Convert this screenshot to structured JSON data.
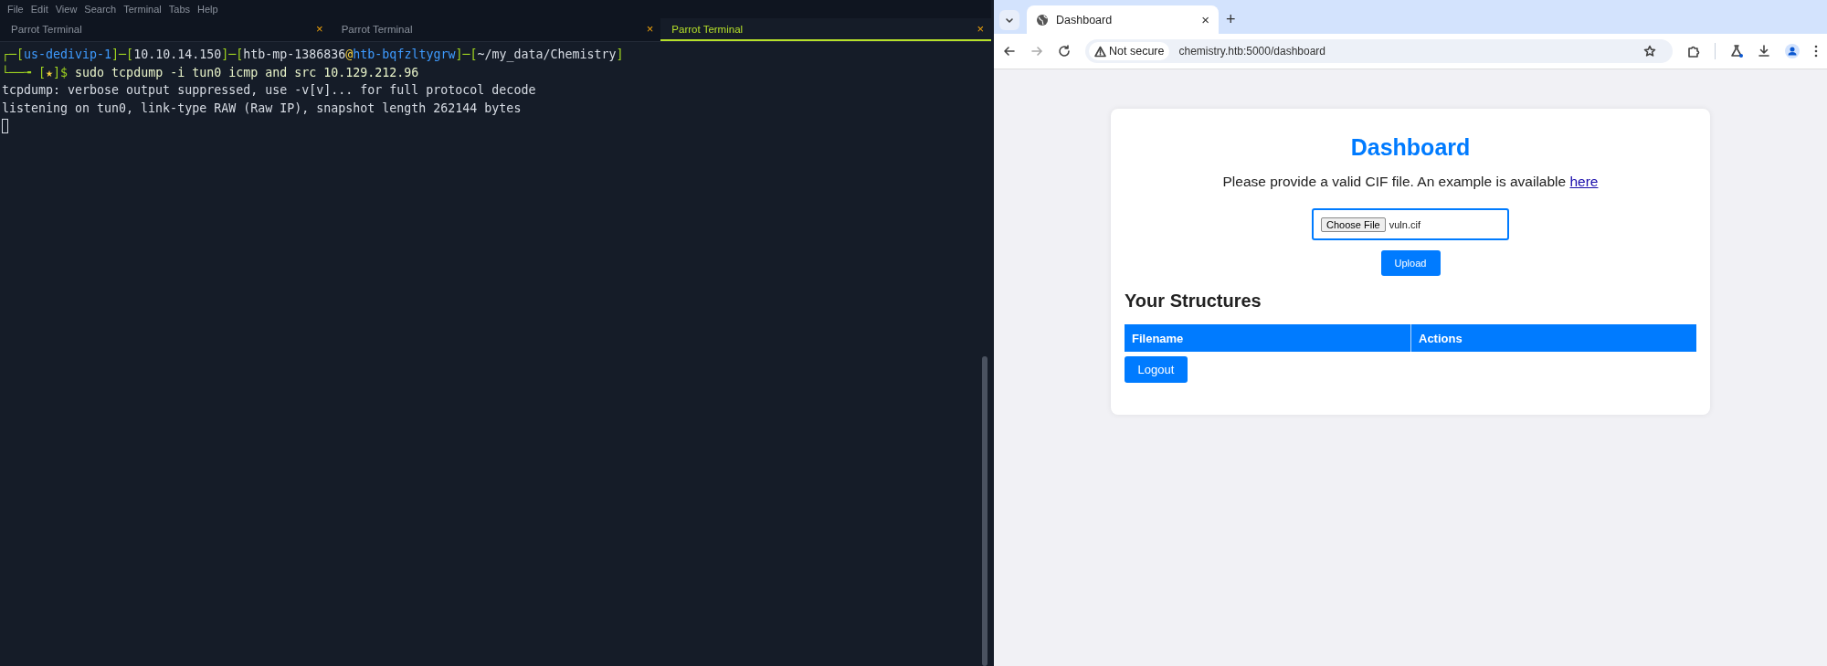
{
  "terminal": {
    "menu": [
      "File",
      "Edit",
      "View",
      "Search",
      "Terminal",
      "Tabs",
      "Help"
    ],
    "tabs": [
      {
        "label": "Parrot Terminal",
        "close": "×",
        "selected": false
      },
      {
        "label": "Parrot Terminal",
        "close": "×",
        "selected": false
      },
      {
        "label": "Parrot Terminal",
        "close": "×",
        "selected": true
      }
    ],
    "prompt_line_1": [
      {
        "kind": "frame",
        "text": "┌─["
      },
      {
        "kind": "host",
        "text": "us-dedivip-1"
      },
      {
        "kind": "frame",
        "text": "]─["
      },
      {
        "kind": "plain",
        "text": "10.10.14.150"
      },
      {
        "kind": "frame",
        "text": "]─["
      },
      {
        "kind": "plain",
        "text": "htb-mp-1386836"
      },
      {
        "kind": "at",
        "text": "@"
      },
      {
        "kind": "host",
        "text": "htb-bqfzltygrw"
      },
      {
        "kind": "frame",
        "text": "]─["
      },
      {
        "kind": "plain",
        "text": "~/my_data/Chemistry"
      },
      {
        "kind": "frame",
        "text": "]"
      }
    ],
    "prompt_line_2": [
      {
        "kind": "frame",
        "text": "└──╼ ["
      },
      {
        "kind": "at",
        "text": "★"
      },
      {
        "kind": "frame",
        "text": "]$"
      },
      {
        "kind": "command",
        "text": " sudo tcpdump -i tun0 icmp and src 10.129.212.96"
      }
    ],
    "output": [
      "tcpdump: verbose output suppressed, use -v[v]... for full protocol decode",
      "listening on tun0, link-type RAW (Raw IP), snapshot length 262144 bytes"
    ]
  },
  "browser": {
    "tab": {
      "title": "Dashboard",
      "close": "×",
      "selected": true
    },
    "new_tab": "+",
    "security_chip": "Not secure",
    "url": "chemistry.htb:5000/dashboard",
    "page": {
      "heading": "Dashboard",
      "intro": "Please provide a valid CIF file. An example is available",
      "intro_link": "here",
      "file_input": {
        "button": "Choose File",
        "value": "vuln.cif"
      },
      "upload_button": "Upload",
      "section_title": "Your Structures",
      "table": {
        "columns": [
          "Filename",
          "Actions"
        ]
      },
      "logout_button": "Logout"
    }
  }
}
